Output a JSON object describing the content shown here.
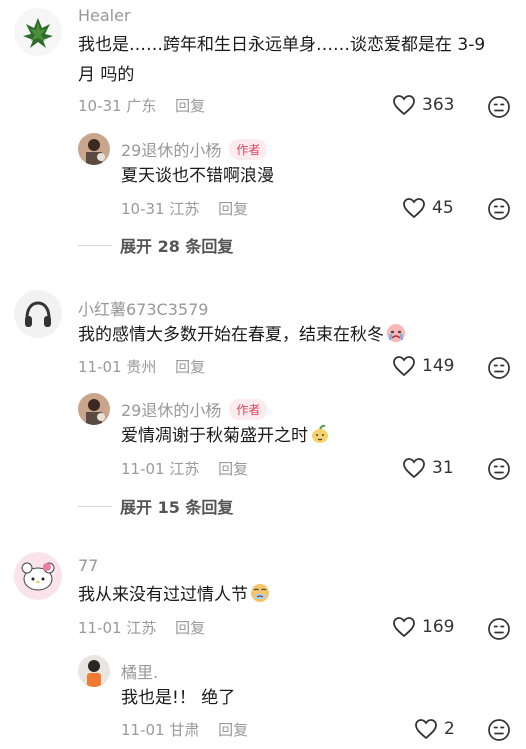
{
  "comments": [
    {
      "user": "Healer",
      "text": "我也是……跨年和生日永远单身……谈恋爱都是在 3-9 月 吗的",
      "date": "10-31",
      "location": "广东",
      "reply_label": "回复",
      "likes": "363",
      "reply": {
        "user": "29退休的小杨",
        "tag": "作者",
        "text": "夏天谈也不错啊浪漫",
        "date": "10-31",
        "location": "江苏",
        "reply_label": "回复",
        "likes": "45"
      },
      "expand": "展开 28 条回复"
    },
    {
      "user": "小红薯673C3579",
      "text": "我的感情大多数开始在春夏，结束在秋冬",
      "date": "11-01",
      "location": "贵州",
      "reply_label": "回复",
      "likes": "149",
      "reply": {
        "user": "29退休的小杨",
        "tag": "作者",
        "text": "爱情凋谢于秋菊盛开之时",
        "date": "11-01",
        "location": "江苏",
        "reply_label": "回复",
        "likes": "31"
      },
      "expand": "展开 15 条回复"
    },
    {
      "user": "77",
      "text": "我从来没有过过情人节",
      "date": "11-01",
      "location": "江苏",
      "reply_label": "回复",
      "likes": "169",
      "reply": {
        "user": "橘里.",
        "text": "我也是!！ 绝了",
        "date": "11-01",
        "location": "甘肃",
        "reply_label": "回复",
        "likes": "2"
      }
    }
  ],
  "icons": {
    "like": "heart-outline-icon",
    "dislike": "dislike-face-icon"
  },
  "colors": {
    "author_tag": "#e0445b",
    "secondary_text": "#999999"
  }
}
